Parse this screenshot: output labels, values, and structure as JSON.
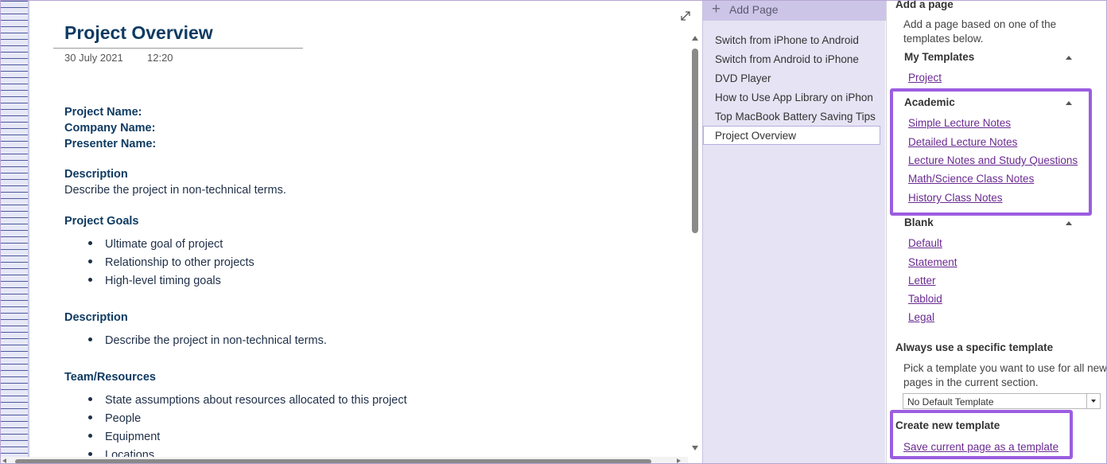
{
  "note": {
    "title": "Project Overview",
    "date": "30 July 2021",
    "time": "12:20",
    "fields": [
      "Project Name:",
      "Company Name:",
      "Presenter Name:"
    ],
    "description_heading": "Description",
    "description_text": "Describe the project in non-technical terms.",
    "goals_heading": "Project Goals",
    "goals": [
      "Ultimate goal of project",
      "Relationship to other projects",
      "High-level timing goals"
    ],
    "description2_heading": "Description",
    "description2_bullets": [
      "Describe the project in non-technical terms."
    ],
    "team_heading": "Team/Resources",
    "team_bullets": [
      "State assumptions about resources allocated to this project",
      "People",
      "Equipment",
      "Locations"
    ]
  },
  "page_list": {
    "add_page_label": "Add Page",
    "items": [
      "Switch from iPhone to Android",
      "Switch from Android to iPhone",
      "DVD Player",
      "How to Use App Library on iPhon",
      "Top MacBook Battery Saving Tips",
      "Project Overview"
    ],
    "selected_index": 5
  },
  "templates": {
    "add_a_page_heading": "Add a page",
    "intro_line1": "Add a page based on one of the",
    "intro_line2": "templates below.",
    "my_templates_heading": "My Templates",
    "my_templates": [
      "Project"
    ],
    "academic_heading": "Academic",
    "academic": [
      "Simple Lecture Notes",
      "Detailed Lecture Notes",
      "Lecture Notes and Study Questions",
      "Math/Science Class Notes",
      "History Class Notes"
    ],
    "blank_heading": "Blank",
    "blank": [
      "Default",
      "Statement",
      "Letter",
      "Tabloid",
      "Legal"
    ],
    "always_use_heading": "Always use a specific template",
    "always_use_line1": "Pick a template you want to use for all new",
    "always_use_line2": "pages in the current section.",
    "default_template_value": "No Default Template",
    "create_heading": "Create new template",
    "save_link": "Save current page as a template"
  },
  "colors": {
    "highlight": "#9b5de0",
    "link": "#6a2a91",
    "title": "#0f3b62",
    "page_pane_bg": "#e6e3f4"
  },
  "icons": [
    "expand-icon",
    "plus-icon",
    "caret-up-icon",
    "dropdown-arrow-icon"
  ]
}
